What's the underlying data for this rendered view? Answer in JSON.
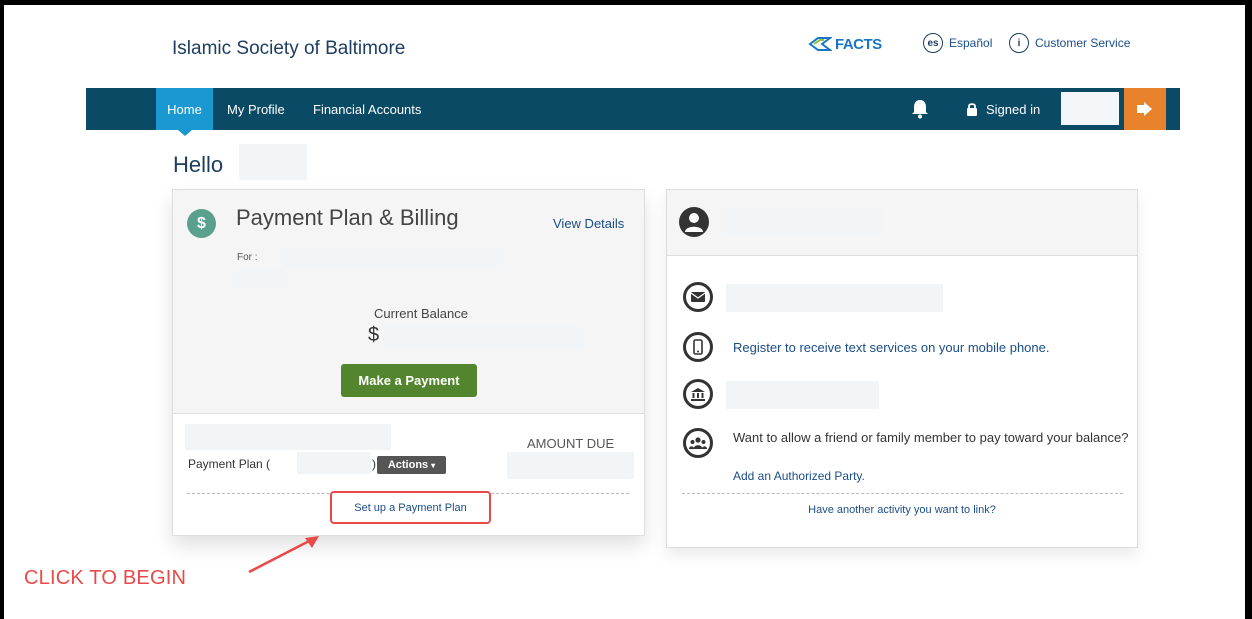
{
  "header": {
    "org_name": "Islamic Society of Baltimore",
    "logo_text": "FACTS",
    "language_icon_text": "es",
    "language_label": "Español",
    "info_icon_text": "i",
    "customer_service_label": "Customer Service"
  },
  "nav": {
    "items": [
      {
        "label": "Home",
        "active": true
      },
      {
        "label": "My Profile",
        "active": false
      },
      {
        "label": "Financial Accounts",
        "active": false
      }
    ],
    "signed_in_label": "Signed in"
  },
  "greeting": "Hello",
  "payment_card": {
    "icon_text": "$",
    "title": "Payment Plan & Billing",
    "view_details": "View Details",
    "for_label": "For :",
    "current_balance_label": "Current Balance",
    "balance_prefix": "$",
    "make_payment_button": "Make a Payment",
    "amount_due_label": "AMOUNT DUE",
    "payment_plan_label": "Payment Plan (",
    "payment_plan_close": ")",
    "actions_button": "Actions",
    "setup_link": "Set up a Payment Plan"
  },
  "profile_card": {
    "sms_link": "Register to receive text services on your mobile phone.",
    "authorized_text": "Want to allow a friend or family member to pay toward your balance?",
    "authorized_link": "Add an Authorized Party.",
    "another_activity_link": "Have another activity you want to link?"
  },
  "annotation": {
    "callout_text": "CLICK TO BEGIN",
    "color": "#e84a4a"
  },
  "colors": {
    "nav_bg": "#0b4a64",
    "nav_active": "#1a98d2",
    "logout_bg": "#e8822b",
    "pay_button": "#53852e",
    "link": "#1a4d8a"
  }
}
